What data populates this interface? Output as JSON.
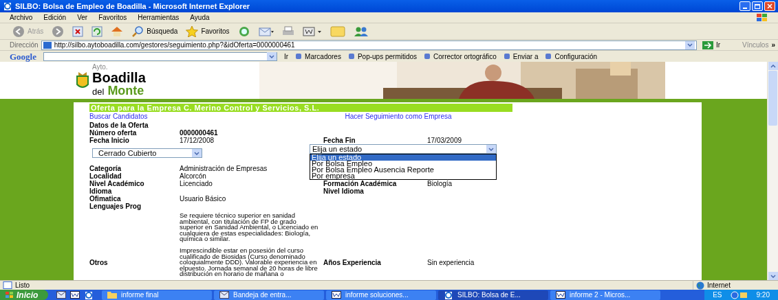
{
  "window": {
    "title": "SILBO: Bolsa de Empleo de Boadilla - Microsoft Internet Explorer"
  },
  "menu": [
    "Archivo",
    "Edición",
    "Ver",
    "Favoritos",
    "Herramientas",
    "Ayuda"
  ],
  "toolbar": [
    {
      "kind": "back",
      "label": "Atrás",
      "disabled": true
    },
    {
      "kind": "forward"
    },
    {
      "kind": "stop"
    },
    {
      "kind": "refresh"
    },
    {
      "kind": "home"
    },
    {
      "kind": "search",
      "label": "Búsqueda"
    },
    {
      "kind": "favorites",
      "label": "Favoritos"
    },
    {
      "kind": "history"
    },
    {
      "kind": "mail"
    },
    {
      "kind": "print"
    },
    {
      "kind": "word"
    },
    {
      "kind": "note"
    },
    {
      "kind": "people"
    }
  ],
  "address": {
    "label": "Dirección",
    "url": "http://silbo.aytoboadilla.com/gestores/seguimiento.php?&idOferta=0000000461",
    "go": "Ir",
    "links": "Vínculos",
    "more": "»"
  },
  "google_bar": {
    "logo": "Google",
    "go": "Ir",
    "items": [
      "Marcadores",
      "Pop-ups permitidos",
      "Corrector ortográfico",
      "Enviar a",
      "Configuración"
    ]
  },
  "page": {
    "logo": {
      "small": "Ayto.",
      "name": "Boadilla",
      "prefix": "del",
      "suffix": "Monte"
    },
    "offer_title": "Oferta para la Empresa C. Merino Control y Servicios, S.L.",
    "links": [
      "Buscar Candidatos",
      "Hacer Seguimiento como Empresa"
    ],
    "section": "Datos de la Oferta",
    "number": {
      "label": "Número oferta",
      "value": "0000000461"
    },
    "dates": [
      {
        "label": "Fecha Inicio",
        "value": "17/12/2008"
      },
      {
        "label": "Fecha Fin",
        "value": "17/03/2009"
      }
    ],
    "status_select": {
      "value": "Cerrado Cubierto"
    },
    "tracking_select": {
      "value": "Elija un estado",
      "expanded": true,
      "options": [
        {
          "label": "Elija un estado",
          "selected": true
        },
        {
          "label": "Por Bolsa Empleo",
          "selected": false
        },
        {
          "label": "Por Bolsa Empleo Ausencia Reporte",
          "selected": false
        },
        {
          "label": "Por empresa",
          "selected": false
        }
      ]
    },
    "rows": [
      {
        "label": "Categoría",
        "value": "Administración de Empresas"
      },
      {
        "label": "Localidad",
        "value": "Alcorcón"
      },
      {
        "label": "Nivel Académico",
        "value": "Licenciado",
        "label2": "Formación Académica",
        "value2": "Biología"
      },
      {
        "label": "Idioma",
        "label2": "Nivel Idioma"
      },
      {
        "label": "Ofimatica",
        "value": "Usuario Básico"
      },
      {
        "label": "Lenguajes Prog"
      },
      {
        "value": "Se requiere técnico superior en sanidad ambiental, con titulación de FP de grado superior en Sanidad Ambiental, o Licenciado en cualquiera de estas especialidades: Biología, química o similar."
      },
      {
        "label": "Otros",
        "value": "Imprescindible estar en posesión del curso cualificado de Biosidas (Curso denominado coloquialmente DDD). Valorable experiencia en elpuesto. Jornada semanal de 20 horas de libre distribución en horario de mañana o",
        "label2": "Años Experiencia",
        "value2": "Sin experiencia"
      }
    ]
  },
  "status_bar": {
    "text": "Listo",
    "zone": "Internet"
  },
  "taskbar": {
    "start": "Inicio",
    "tasks": [
      {
        "kind": "folder",
        "label": "informe final",
        "selected": false
      },
      {
        "kind": "mail",
        "label": "Bandeja de entra...",
        "selected": false
      },
      {
        "kind": "word",
        "label": "informe soluciones...",
        "selected": false
      },
      {
        "kind": "ie",
        "label": "SILBO: Bolsa de E...",
        "selected": true
      },
      {
        "kind": "word",
        "label": "informe 2 - Micros...",
        "selected": false
      }
    ],
    "lang": "ES",
    "time": "9:20"
  }
}
